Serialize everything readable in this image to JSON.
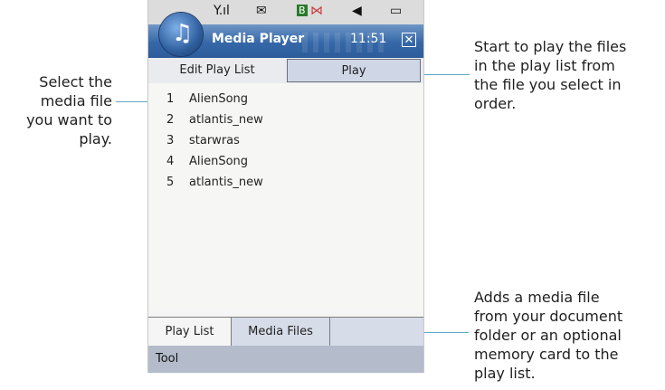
{
  "annotations": {
    "select_file": [
      "Select the",
      "media file",
      "you want to",
      "play."
    ],
    "play_desc": [
      "Start to play the files",
      "in the play list from",
      "the file you select in",
      "order."
    ],
    "media_files_desc": [
      "Adds a media file",
      "from your document",
      "folder or an optional",
      "memory card to the",
      "play list."
    ]
  },
  "status_bar": {
    "icons": [
      "signal-icon",
      "message-icon",
      "bluetooth-icon",
      "network-icon",
      "volume-icon",
      "battery-icon"
    ],
    "glyphs": [
      "Y.ıl",
      "✉",
      "B",
      "⋈",
      "◀",
      "▭"
    ]
  },
  "app": {
    "title": "Media Player",
    "time": "11:51",
    "close_glyph": "✕"
  },
  "top_tabs": {
    "edit": "Edit Play List",
    "play": "Play"
  },
  "playlist": [
    {
      "num": "1",
      "name": "AlienSong"
    },
    {
      "num": "2",
      "name": "atlantis_new"
    },
    {
      "num": "3",
      "name": "starwras"
    },
    {
      "num": "4",
      "name": "AlienSong"
    },
    {
      "num": "5",
      "name": "atlantis_new"
    }
  ],
  "bottom_tabs": {
    "play_list": "Play List",
    "media_files": "Media Files"
  },
  "softkeys": {
    "left": "Tool"
  },
  "colors": {
    "title_bar": "#3567a8",
    "callout_line": "#62a7c8",
    "softkey_bar": "#b4bccb",
    "selected_tab": "#cfd7e6"
  }
}
